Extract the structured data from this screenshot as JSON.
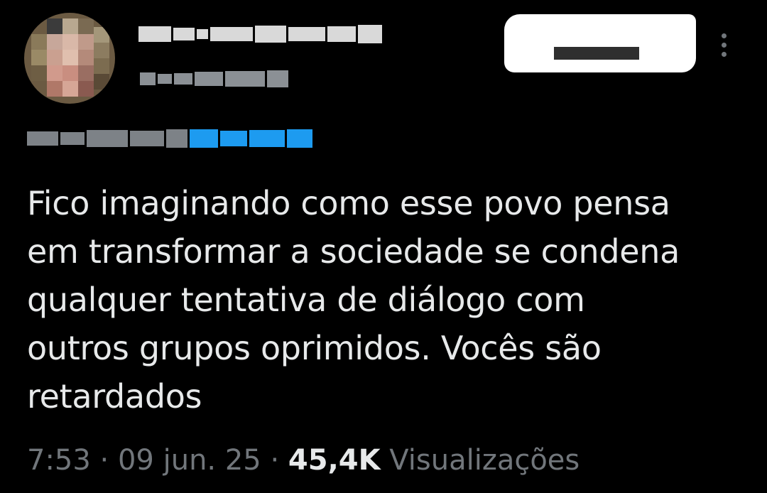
{
  "tweet": {
    "text": "Fico imaginando como esse povo pensa\nem transformar a sociedade se condena\nqualquer tentativa de diálogo com\noutros grupos oprimidos. Vocês são\nretardados",
    "time": "7:53",
    "separator": " · ",
    "date": "09 jun. 25",
    "views_count": "45,4K",
    "views_label": " Visualizações"
  },
  "icons": {
    "more": "more-vertical-icon"
  },
  "colors": {
    "background": "#000000",
    "text_primary": "#e7e9ea",
    "text_secondary": "#71767b",
    "link": "#1d9bf0"
  }
}
